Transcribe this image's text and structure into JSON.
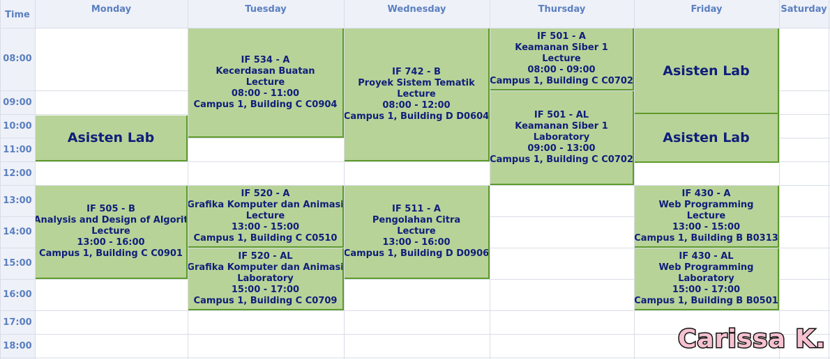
{
  "header": {
    "time": "Time",
    "days": [
      "Monday",
      "Tuesday",
      "Wednesday",
      "Thursday",
      "Friday",
      "Saturday"
    ]
  },
  "times": [
    "08:00",
    "09:00",
    "10:00",
    "11:00",
    "12:00",
    "13:00",
    "14:00",
    "15:00",
    "16:00",
    "17:00",
    "18:00"
  ],
  "events": {
    "mon_lab": {
      "title": "Asisten Lab"
    },
    "mon_505": {
      "line1": "IF 505 - B",
      "line2": "Analysis and Design of Algorit",
      "line3": "Lecture",
      "line4": "13:00 - 16:00",
      "line5": "Campus 1, Building C C0901"
    },
    "tue_534": {
      "line1": "IF 534 - A",
      "line2": "Kecerdasan Buatan",
      "line3": "Lecture",
      "line4": "08:00 - 11:00",
      "line5": "Campus 1, Building C C0904"
    },
    "tue_520a": {
      "line1": "IF 520 - A",
      "line2": "Grafika Komputer dan Animasi",
      "line3": "Lecture",
      "line4": "13:00 - 15:00",
      "line5": "Campus 1, Building C C0510"
    },
    "tue_520al": {
      "line1": "IF 520 - AL",
      "line2": "Grafika Komputer dan Animasi",
      "line3": "Laboratory",
      "line4": "15:00 - 17:00",
      "line5": "Campus 1, Building C C0709"
    },
    "wed_742": {
      "line1": "IF 742 - B",
      "line2": "Proyek Sistem Tematik",
      "line3": "Lecture",
      "line4": "08:00 - 12:00",
      "line5": "Campus 1, Building D D0604"
    },
    "wed_511": {
      "line1": "IF 511 - A",
      "line2": "Pengolahan Citra",
      "line3": "Lecture",
      "line4": "13:00 - 16:00",
      "line5": "Campus 1, Building D D0906"
    },
    "thu_501a": {
      "line1": "IF 501 - A",
      "line2": "Keamanan Siber 1",
      "line3": "Lecture",
      "line4": "08:00 - 09:00",
      "line5": "Campus 1, Building C C0702"
    },
    "thu_501al": {
      "line1": "IF 501 - AL",
      "line2": "Keamanan Siber 1",
      "line3": "Laboratory",
      "line4": "09:00 - 13:00",
      "line5": "Campus 1, Building C C0702"
    },
    "fri_lab1": {
      "title": "Asisten Lab"
    },
    "fri_lab2": {
      "title": "Asisten Lab"
    },
    "fri_430a": {
      "line1": "IF 430 - A",
      "line2": "Web Programming",
      "line3": "Lecture",
      "line4": "13:00 - 15:00",
      "line5": "Campus 1, Building B B0313"
    },
    "fri_430al": {
      "line1": "IF 430 - AL",
      "line2": "Web Programming",
      "line3": "Laboratory",
      "line4": "15:00 - 17:00",
      "line5": "Campus 1, Building B B0501"
    }
  },
  "watermark": "Carissa K.",
  "colors": {
    "event_bg": "#b8d398",
    "event_border": "#5d9a2a",
    "event_text": "#0f1e7a",
    "header_text": "#5b7fc0"
  }
}
